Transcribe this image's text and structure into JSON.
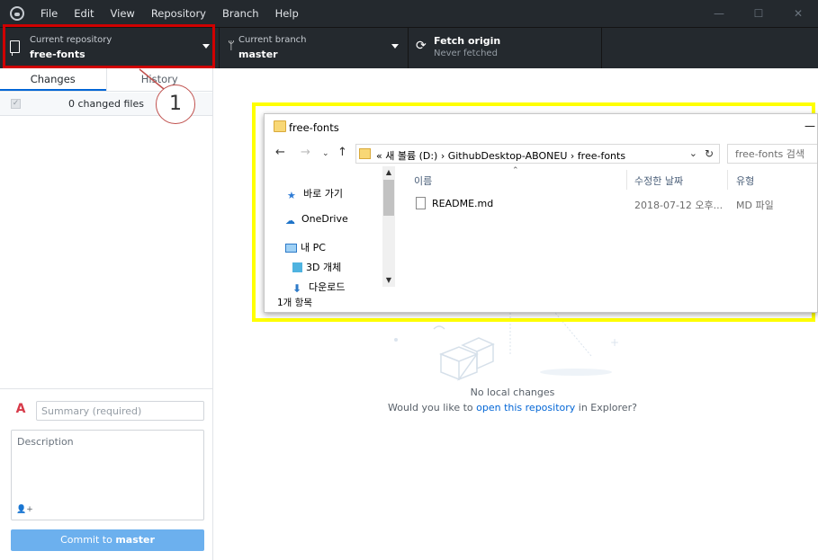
{
  "menu": [
    "File",
    "Edit",
    "View",
    "Repository",
    "Branch",
    "Help"
  ],
  "window_controls": {
    "minimize": "—",
    "maximize": "☐",
    "close": "✕"
  },
  "toolbar": {
    "repo": {
      "label": "Current repository",
      "value": "free-fonts"
    },
    "branch": {
      "label": "Current branch",
      "value": "master"
    },
    "fetch": {
      "title": "Fetch origin",
      "sub": "Never fetched"
    }
  },
  "sidebar": {
    "tabs": [
      "Changes",
      "History"
    ],
    "changed_files": "0 changed files"
  },
  "commit": {
    "summary_placeholder": "Summary (required)",
    "description_placeholder": "Description",
    "button_prefix": "Commit to ",
    "button_branch": "master"
  },
  "main": {
    "no_changes": "No local changes",
    "ask_prefix": "Would you like to ",
    "ask_link": "open this repository",
    "ask_suffix": " in Explorer?"
  },
  "explorer": {
    "title": "free-fonts",
    "address": "«  새 볼륨 (D:)  ›  GithubDesktop-ABONEU  ›  free-fonts",
    "search_placeholder": "free-fonts 검색",
    "nav_items": [
      "바로 가기",
      "OneDrive",
      "내 PC",
      "3D 개체",
      "다운로드"
    ],
    "columns": [
      "이름",
      "수정한 날짜",
      "유형"
    ],
    "files": [
      {
        "name": "README.md",
        "date": "2018-07-12 오후...",
        "type": "MD 파일"
      }
    ],
    "status": "1개 항목"
  },
  "callout": "1",
  "colors": {
    "highlight_red": "#d00000",
    "highlight_yellow": "#ffff00",
    "dark": "#24292e",
    "commit_button": "#6cb0ee",
    "link": "#0366d6"
  }
}
